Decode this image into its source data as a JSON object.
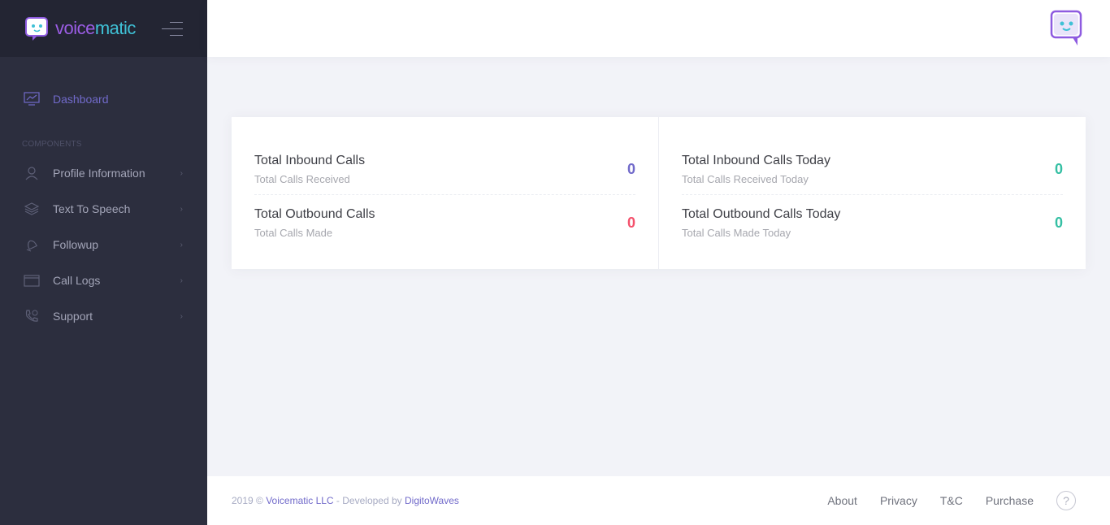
{
  "brand": {
    "name_part1": "voice",
    "name_part2": "matic"
  },
  "sidebar": {
    "dashboard_label": "Dashboard",
    "section_title": "COMPONENTS",
    "items": [
      {
        "label": "Profile Information",
        "icon": "user-icon"
      },
      {
        "label": "Text To Speech",
        "icon": "layers-icon"
      },
      {
        "label": "Followup",
        "icon": "bell-icon"
      },
      {
        "label": "Call Logs",
        "icon": "window-icon"
      },
      {
        "label": "Support",
        "icon": "phone-icon"
      }
    ]
  },
  "stats": {
    "inbound": {
      "title": "Total Inbound Calls",
      "sub": "Total Calls Received",
      "value": "0",
      "color": "#716aca"
    },
    "outbound": {
      "title": "Total Outbound Calls",
      "sub": "Total Calls Made",
      "value": "0",
      "color": "#f4516c"
    },
    "inbound_today": {
      "title": "Total Inbound Calls Today",
      "sub": "Total Calls Received Today",
      "value": "0",
      "color": "#34bfa3"
    },
    "outbound_today": {
      "title": "Total Outbound Calls Today",
      "sub": "Total Calls Made Today",
      "value": "0",
      "color": "#34bfa3"
    }
  },
  "footer": {
    "copy_prefix": "2019 © ",
    "company": "Voicematic LLC",
    "developed_by": " - Developed by ",
    "developer": "DigitoWaves",
    "links": [
      "About",
      "Privacy",
      "T&C",
      "Purchase"
    ],
    "help": "?"
  }
}
